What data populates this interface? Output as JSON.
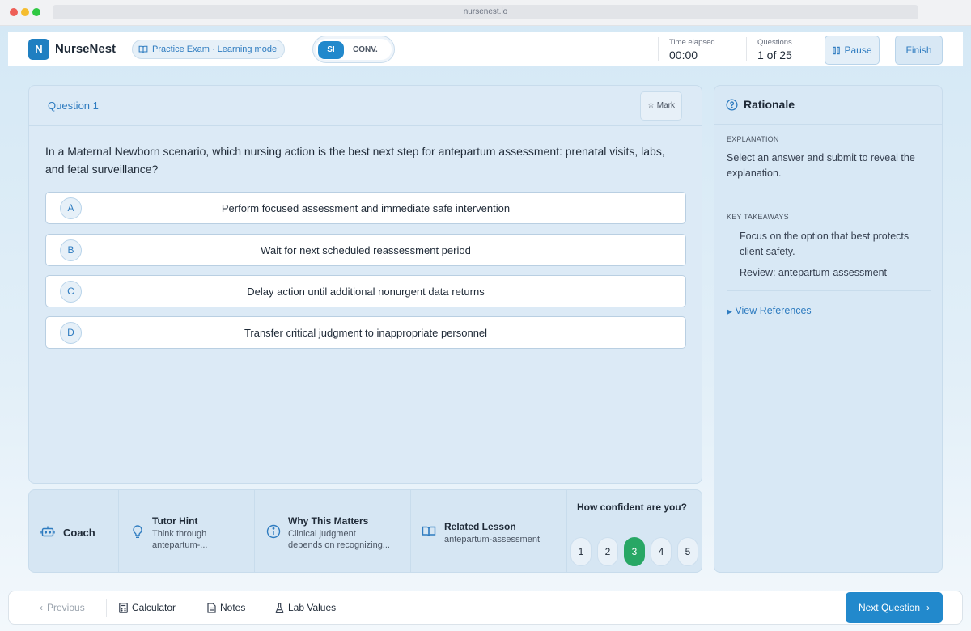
{
  "browser": {
    "url": "nursenest.io"
  },
  "header": {
    "logo_letter": "N",
    "brand": "NurseNest",
    "mode_label": "Practice Exam · Learning mode",
    "units": {
      "si": "SI",
      "conv": "CONV."
    },
    "time_label": "Time elapsed",
    "time_value": "00:00",
    "questions_label": "Questions",
    "questions_value": "1 of 25",
    "pause_label": "Pause",
    "finish_label": "Finish"
  },
  "question": {
    "title": "Question 1",
    "mark_label": "Mark",
    "text": "In a Maternal Newborn scenario, which nursing action is the best next step for antepartum assessment: prenatal visits, labs, and fetal surveillance?",
    "options": [
      {
        "letter": "A",
        "text": "Perform focused assessment and immediate safe intervention"
      },
      {
        "letter": "B",
        "text": "Wait for next scheduled reassessment period"
      },
      {
        "letter": "C",
        "text": "Delay action until additional nonurgent data returns"
      },
      {
        "letter": "D",
        "text": "Transfer critical judgment to inappropriate personnel"
      }
    ]
  },
  "tools": {
    "coach": "Coach",
    "tutor": {
      "title": "Tutor Hint",
      "line1": "Think through",
      "line2": "antepartum-..."
    },
    "why": {
      "title": "Why This Matters",
      "line1": "Clinical judgment",
      "line2": "depends on recognizing..."
    },
    "lesson": {
      "title": "Related Lesson",
      "sub": "antepartum-assessment"
    },
    "confidence": {
      "question": "How confident are you?",
      "levels": [
        "1",
        "2",
        "3",
        "4",
        "5"
      ],
      "selected": "3"
    }
  },
  "rationale": {
    "title": "Rationale",
    "explanation_label": "EXPLANATION",
    "explanation_text": "Select an answer and submit to reveal the explanation.",
    "takeaways_label": "KEY TAKEAWAYS",
    "takeaway_1": "Focus on the option that best protects client safety.",
    "takeaway_2": "Review: antepartum-assessment",
    "references_label": "View References"
  },
  "footer": {
    "previous": "Previous",
    "calculator": "Calculator",
    "notes": "Notes",
    "lab_values": "Lab Values",
    "next": "Next Question"
  },
  "colors": {
    "accent": "#2289cc",
    "selected": "#28a765"
  }
}
